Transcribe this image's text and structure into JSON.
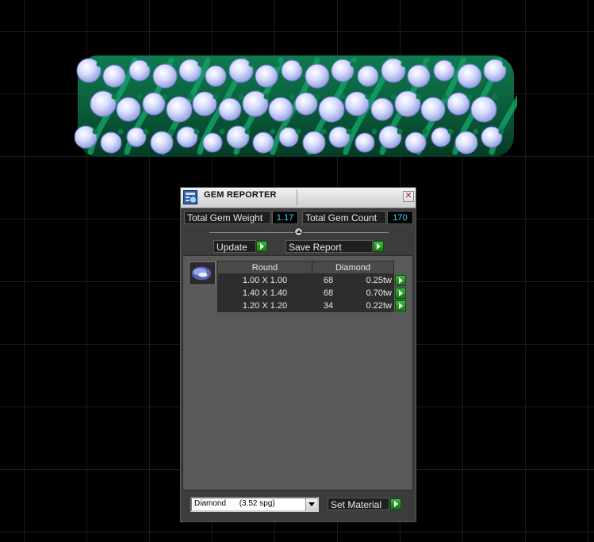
{
  "window": {
    "title": "GEM REPORTER",
    "close_glyph": "✕"
  },
  "stats": {
    "total_weight_label": "Total Gem Weight",
    "total_weight_value": "1.17",
    "total_count_label": "Total Gem Count",
    "total_count_value": "170"
  },
  "toolbar": {
    "update_label": "Update",
    "save_report_label": "Save Report"
  },
  "gem_table": {
    "shape_header": "Round",
    "material_header": "Diamond",
    "rows": [
      {
        "size": "1.00 X 1.00",
        "count": "68",
        "weight": "0.25tw"
      },
      {
        "size": "1.40 X 1.40",
        "count": "68",
        "weight": "0.70tw"
      },
      {
        "size": "1.20 X 1.20",
        "count": "34",
        "weight": "0.22tw"
      }
    ]
  },
  "material": {
    "selected": "Diamond      (3.52 spg)",
    "set_material_label": "Set Material"
  },
  "colors": {
    "accent_cyan": "#31e4ff",
    "go_green": "#2aa52a",
    "ring_metal": "#0b6b45",
    "gem_color": "#c9d4ff"
  },
  "icons": {
    "app": "gem-reporter-app-icon",
    "close": "close-icon",
    "go": "play-arrow-icon",
    "dropdown": "chevron-down-icon",
    "gem_thumb": "round-gem-icon"
  }
}
